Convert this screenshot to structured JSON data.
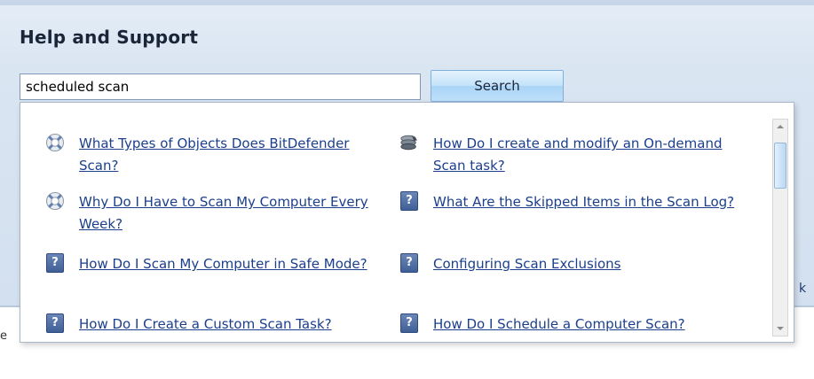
{
  "window": {
    "title": "Help and Support"
  },
  "search": {
    "value": "scheduled scan",
    "button_label": "Search"
  },
  "background_fragments": {
    "right": "k",
    "left": "e"
  },
  "results": [
    {
      "text": "What Types of Objects Does BitDefender Scan?",
      "icon": "lifebuoy-icon",
      "column": "left"
    },
    {
      "text": "How Do I create and modify an On-demand Scan task?",
      "icon": "scan-task-icon",
      "column": "right"
    },
    {
      "text": "Why Do I Have to Scan My Computer Every Week?",
      "icon": "lifebuoy-icon",
      "column": "left"
    },
    {
      "text": "What Are the Skipped Items in the Scan Log?",
      "icon": "question-icon",
      "column": "right"
    },
    {
      "text": "How Do I Scan My Computer in Safe Mode?",
      "icon": "question-icon",
      "column": "left"
    },
    {
      "text": "Configuring Scan Exclusions",
      "icon": "question-icon",
      "column": "right"
    },
    {
      "text": "How Do I Create a Custom Scan Task?",
      "icon": "question-icon",
      "column": "left"
    },
    {
      "text": "How Do I Schedule a Computer Scan?",
      "icon": "question-icon",
      "column": "right"
    }
  ],
  "colors": {
    "link": "#1b3f8c",
    "panel": "#d3e0ef",
    "search_button": "#c5e3fa"
  }
}
